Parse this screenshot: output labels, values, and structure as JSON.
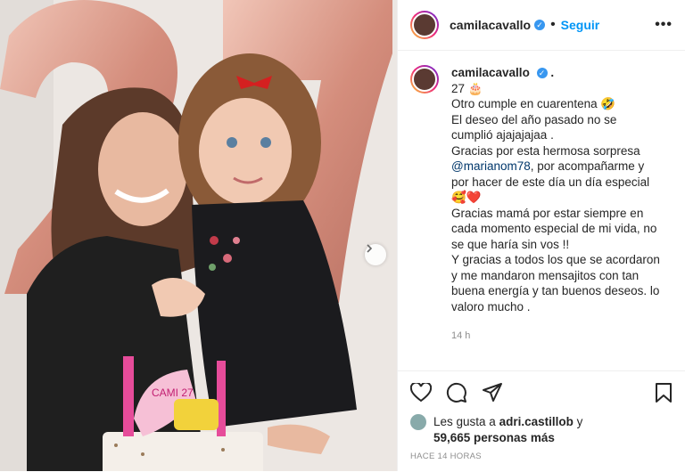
{
  "header": {
    "username": "camilacavallo",
    "verified_icon": "verified-check-icon",
    "follow_label": "Seguir",
    "more_icon": "more-options-icon"
  },
  "caption": {
    "username": "camilacavallo",
    "lines": [
      "27 🎂",
      "Otro cumple en cuarentena 🤣",
      "El deseo del año pasado no se",
      "cumplió ajajajajaa .",
      "Gracias por esta hermosa sorpresa",
      "@marianom78",
      ", por acompañarme y",
      "por hacer de este día un día especial",
      "🥰❤️",
      "Gracias mamá por estar siempre en",
      "cada momento especial de mi vida, no",
      "se que haría sin vos !!",
      "Y gracias a todos los que se acordaron",
      "y me mandaron mensajitos con tan",
      "buena energía y tan buenos deseos. lo",
      "valoro mucho ."
    ],
    "time": "14 h"
  },
  "actions": {
    "like_icon": "heart-icon",
    "comment_icon": "comment-icon",
    "share_icon": "share-icon",
    "save_icon": "bookmark-icon"
  },
  "likes": {
    "prefix": "Les gusta a ",
    "user": "adri.castillob",
    "joiner": " y",
    "count": "59,665 personas más"
  },
  "posted": "HACE 14 HORAS",
  "photo": {
    "cake_text": "CAMI 27",
    "next_icon": "chevron-right-icon"
  },
  "colors": {
    "link": "#0095f6",
    "mention": "#00376b",
    "balloon": "#d89a8a",
    "dress": "#1b1b1e"
  }
}
